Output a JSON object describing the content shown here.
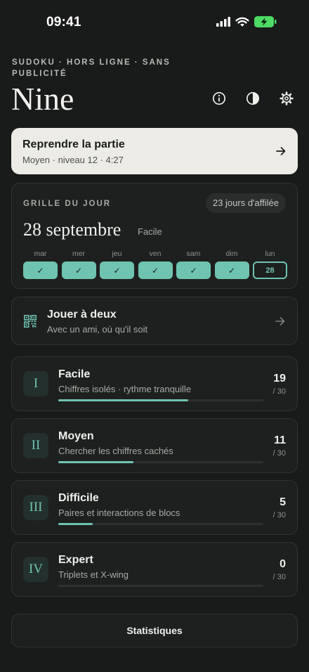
{
  "status_bar": {
    "time": "09:41"
  },
  "header": {
    "kicker": "SUDOKU · HORS LIGNE · SANS PUBLICITÉ",
    "title": "Nine"
  },
  "resume": {
    "title": "Reprendre la partie",
    "subtitle": "Moyen · niveau 12 · 4:27"
  },
  "daily": {
    "label": "GRILLE DU JOUR",
    "streak": "23 jours d'affilée",
    "date": "28 septembre",
    "difficulty": "Facile",
    "days": [
      {
        "name": "mar",
        "mark": "✓"
      },
      {
        "name": "mer",
        "mark": "✓"
      },
      {
        "name": "jeu",
        "mark": "✓"
      },
      {
        "name": "ven",
        "mark": "✓"
      },
      {
        "name": "sam",
        "mark": "✓"
      },
      {
        "name": "dim",
        "mark": "✓"
      },
      {
        "name": "lun",
        "mark": "28"
      }
    ]
  },
  "duo": {
    "title": "Jouer à deux",
    "subtitle": "Avec un ami, où qu'il soit"
  },
  "levels": [
    {
      "numeral": "I",
      "name": "Facile",
      "desc": "Chiffres isolés · rythme tranquille",
      "count": "19",
      "total": "/ 30",
      "progress": 0.633
    },
    {
      "numeral": "II",
      "name": "Moyen",
      "desc": "Chercher les chiffres cachés",
      "count": "11",
      "total": "/ 30",
      "progress": 0.367
    },
    {
      "numeral": "III",
      "name": "Difficile",
      "desc": "Paires et interactions de blocs",
      "count": "5",
      "total": "/ 30",
      "progress": 0.167
    },
    {
      "numeral": "IV",
      "name": "Expert",
      "desc": "Triplets et X-wing",
      "count": "0",
      "total": "/ 30",
      "progress": 0
    }
  ],
  "stats_label": "Statistiques",
  "colors": {
    "accent": "#6fc3b1",
    "background": "#191b1a",
    "card": "#1e201f",
    "resume_card": "#ecebe5",
    "battery": "#4cd964"
  }
}
